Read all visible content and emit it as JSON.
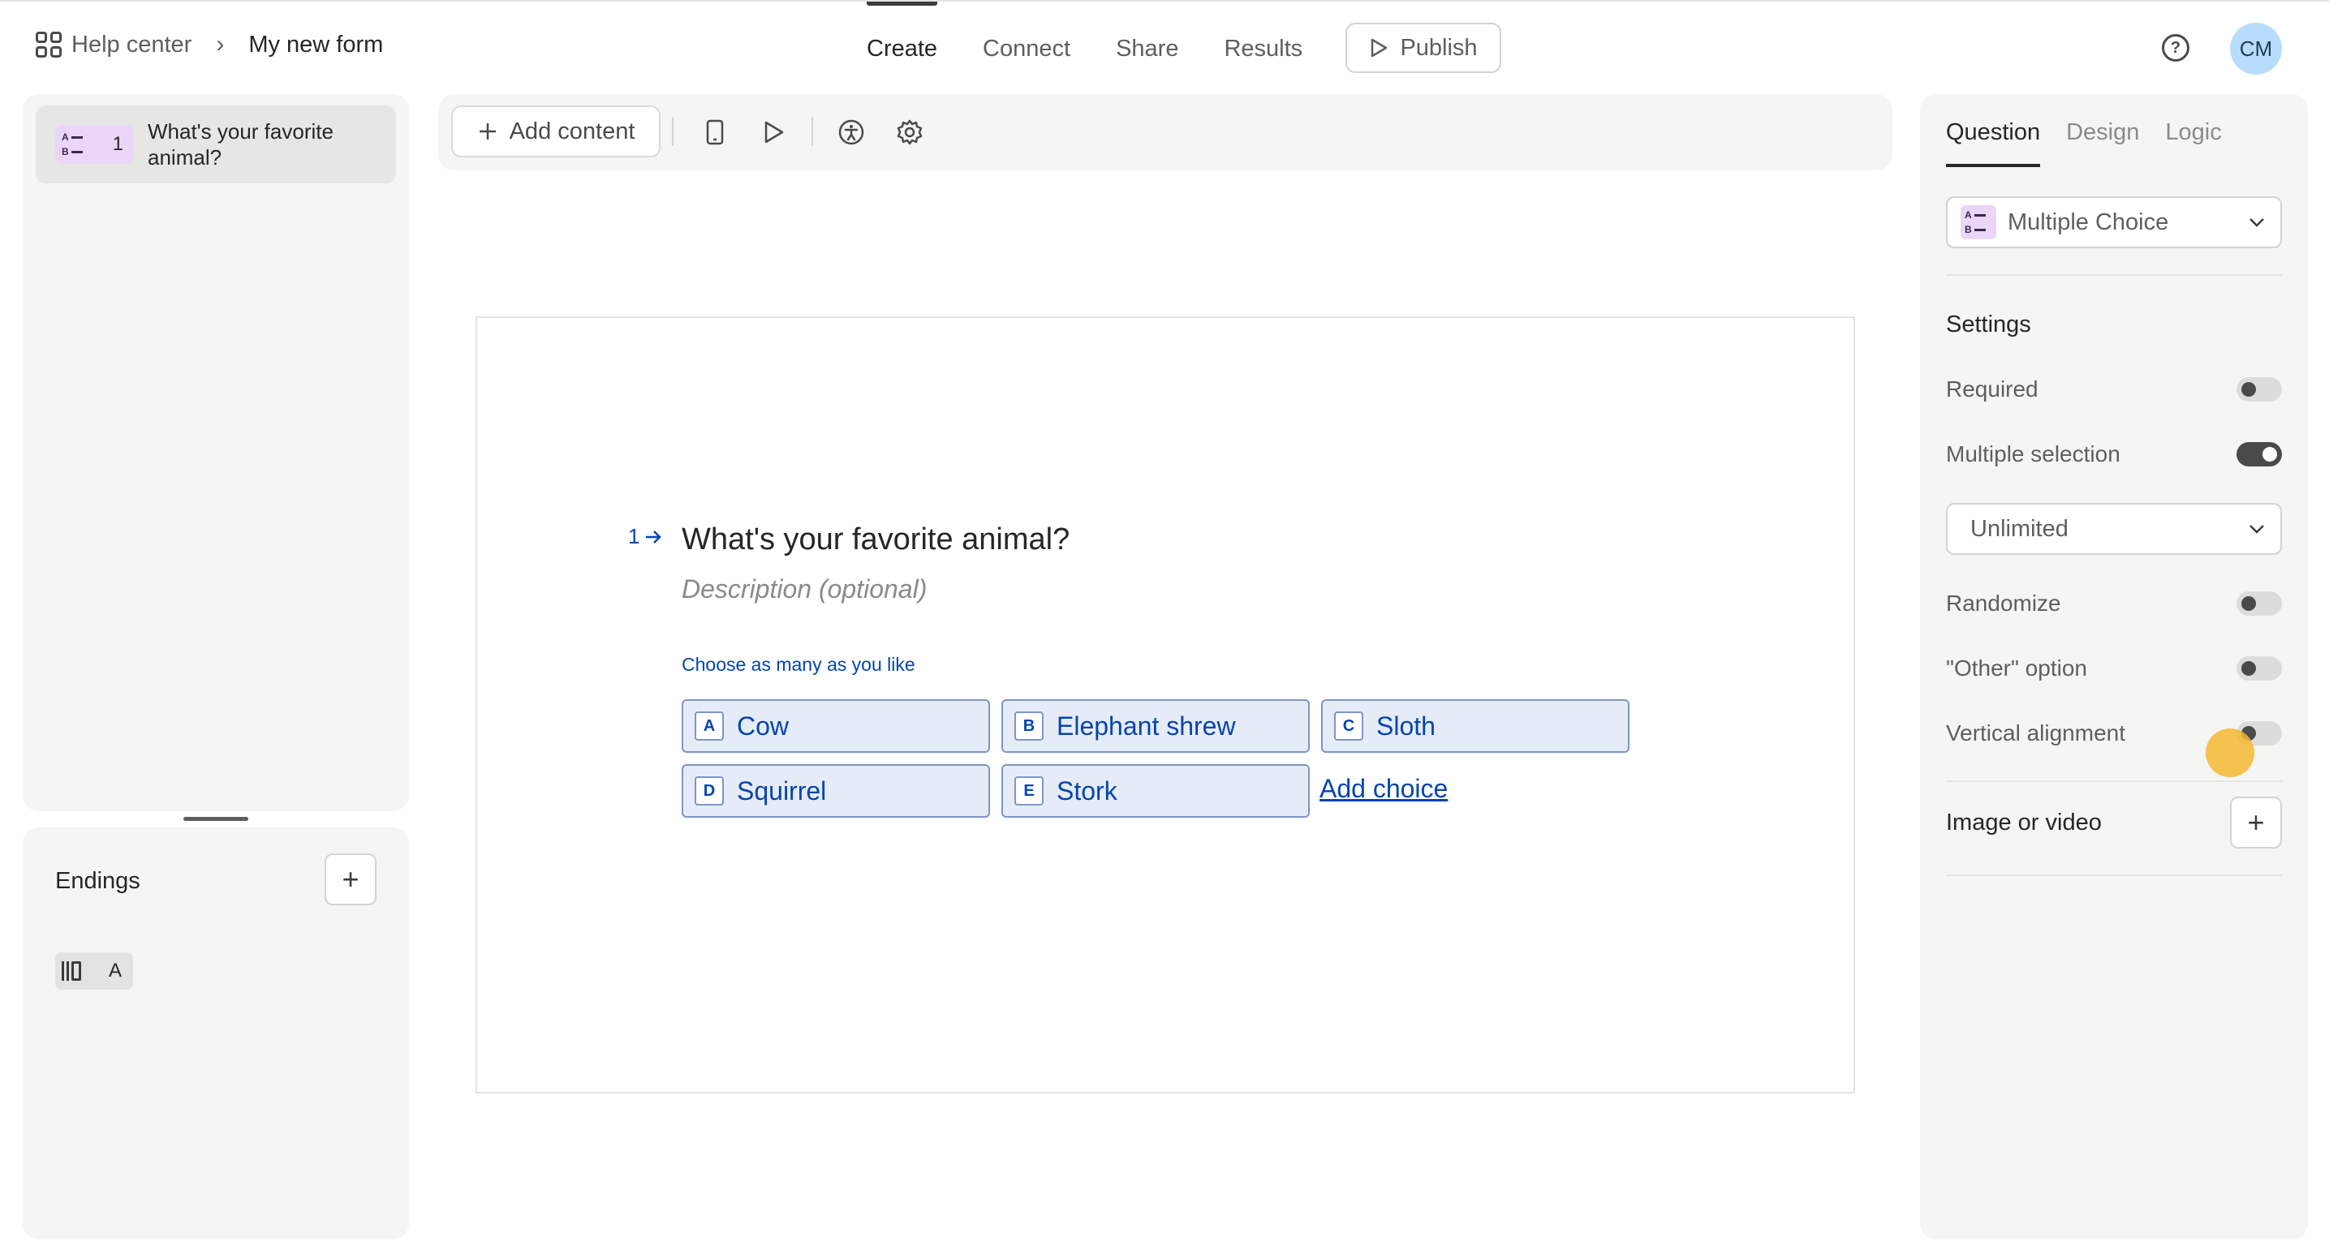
{
  "header": {
    "breadcrumb_root": "Help center",
    "breadcrumb_separator": "›",
    "form_title": "My new form",
    "tabs": [
      {
        "label": "Create",
        "active": true
      },
      {
        "label": "Connect",
        "active": false
      },
      {
        "label": "Share",
        "active": false
      },
      {
        "label": "Results",
        "active": false
      }
    ],
    "publish_label": "Publish",
    "avatar_initials": "CM",
    "help_icon": "question-circle-icon"
  },
  "sidebar": {
    "questions": [
      {
        "number": "1",
        "title": "What's your favorite animal?",
        "type_icon": "multiple-choice-icon"
      }
    ],
    "endings_label": "Endings",
    "endings_add": "+",
    "endings": [
      {
        "label": "A",
        "icon": "ending-icon"
      }
    ]
  },
  "toolbar": {
    "add_content_label": "Add content",
    "icons": [
      "mobile-preview-icon",
      "play-icon",
      "accessibility-icon",
      "gear-icon"
    ]
  },
  "canvas": {
    "question_number": "1",
    "question_title": "What's your favorite animal?",
    "description_placeholder": "Description (optional)",
    "hint": "Choose as many as you like",
    "choices": [
      {
        "key": "A",
        "label": "Cow"
      },
      {
        "key": "B",
        "label": "Elephant shrew"
      },
      {
        "key": "C",
        "label": "Sloth"
      },
      {
        "key": "D",
        "label": "Squirrel"
      },
      {
        "key": "E",
        "label": "Stork"
      }
    ],
    "add_choice_label": "Add choice"
  },
  "right_panel": {
    "tabs": [
      {
        "label": "Question",
        "active": true
      },
      {
        "label": "Design",
        "active": false
      },
      {
        "label": "Logic",
        "active": false
      }
    ],
    "question_type": "Multiple Choice",
    "settings_label": "Settings",
    "settings": [
      {
        "label": "Required",
        "on": false
      },
      {
        "label": "Multiple selection",
        "on": true
      },
      {
        "label": "Randomize",
        "on": false
      },
      {
        "label": "\"Other\" option",
        "on": false
      },
      {
        "label": "Vertical alignment",
        "on": false
      }
    ],
    "selection_limit": "Unlimited",
    "image_video_label": "Image or video",
    "image_video_add": "+"
  },
  "colors": {
    "accent_blue": "#0445af",
    "choice_bg": "#e6ecf7",
    "badge_purple": "#ead6f7",
    "avatar_bg": "#b8dcfb",
    "cursor_highlight": "#f5b731"
  }
}
